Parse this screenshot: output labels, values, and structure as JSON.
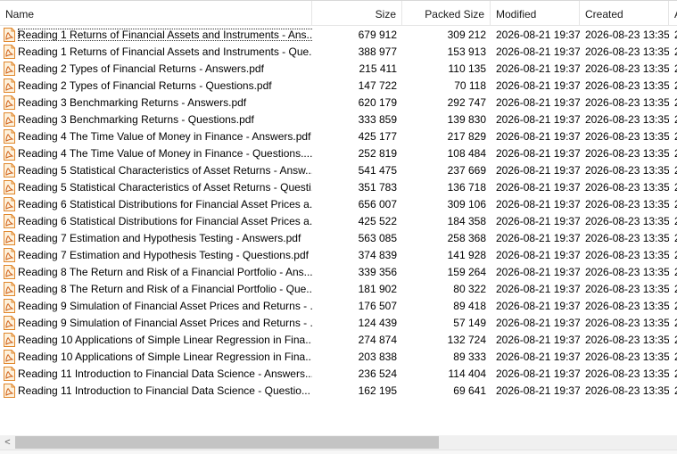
{
  "columns": {
    "name": "Name",
    "size": "Size",
    "packed": "Packed Size",
    "modified": "Modified",
    "created": "Created",
    "next": "A"
  },
  "files": [
    {
      "name": "Reading 1 Returns of Financial Assets and Instruments - Ans...",
      "size": "679 912",
      "packed": "309 212",
      "modified": "2026-08-21 19:37",
      "created": "2026-08-23 13:35",
      "extra": "2"
    },
    {
      "name": "Reading 1 Returns of Financial Assets and Instruments - Que...",
      "size": "388 977",
      "packed": "153 913",
      "modified": "2026-08-21 19:37",
      "created": "2026-08-23 13:35",
      "extra": "2"
    },
    {
      "name": "Reading 2 Types of Financial Returns - Answers.pdf",
      "size": "215 411",
      "packed": "110 135",
      "modified": "2026-08-21 19:37",
      "created": "2026-08-23 13:35",
      "extra": "2"
    },
    {
      "name": "Reading 2 Types of Financial Returns - Questions.pdf",
      "size": "147 722",
      "packed": "70 118",
      "modified": "2026-08-21 19:37",
      "created": "2026-08-23 13:35",
      "extra": "2"
    },
    {
      "name": "Reading 3 Benchmarking Returns - Answers.pdf",
      "size": "620 179",
      "packed": "292 747",
      "modified": "2026-08-21 19:37",
      "created": "2026-08-23 13:35",
      "extra": "2"
    },
    {
      "name": "Reading 3 Benchmarking Returns - Questions.pdf",
      "size": "333 859",
      "packed": "139 830",
      "modified": "2026-08-21 19:37",
      "created": "2026-08-23 13:35",
      "extra": "2"
    },
    {
      "name": "Reading 4 The Time Value of Money in Finance - Answers.pdf",
      "size": "425 177",
      "packed": "217 829",
      "modified": "2026-08-21 19:37",
      "created": "2026-08-23 13:35",
      "extra": "2"
    },
    {
      "name": "Reading 4 The Time Value of Money in Finance - Questions....",
      "size": "252 819",
      "packed": "108 484",
      "modified": "2026-08-21 19:37",
      "created": "2026-08-23 13:35",
      "extra": "2"
    },
    {
      "name": "Reading 5 Statistical Characteristics of Asset Returns - Answ...",
      "size": "541 475",
      "packed": "237 669",
      "modified": "2026-08-21 19:37",
      "created": "2026-08-23 13:35",
      "extra": "2"
    },
    {
      "name": "Reading 5 Statistical Characteristics of Asset Returns - Questi...",
      "size": "351 783",
      "packed": "136 718",
      "modified": "2026-08-21 19:37",
      "created": "2026-08-23 13:35",
      "extra": "2"
    },
    {
      "name": "Reading 6 Statistical Distributions for Financial Asset Prices a...",
      "size": "656 007",
      "packed": "309 106",
      "modified": "2026-08-21 19:37",
      "created": "2026-08-23 13:35",
      "extra": "2"
    },
    {
      "name": "Reading 6 Statistical Distributions for Financial Asset Prices a...",
      "size": "425 522",
      "packed": "184 358",
      "modified": "2026-08-21 19:37",
      "created": "2026-08-23 13:35",
      "extra": "2"
    },
    {
      "name": "Reading 7 Estimation and Hypothesis Testing - Answers.pdf",
      "size": "563 085",
      "packed": "258 368",
      "modified": "2026-08-21 19:37",
      "created": "2026-08-23 13:35",
      "extra": "2"
    },
    {
      "name": "Reading 7 Estimation and Hypothesis Testing - Questions.pdf",
      "size": "374 839",
      "packed": "141 928",
      "modified": "2026-08-21 19:37",
      "created": "2026-08-23 13:35",
      "extra": "2"
    },
    {
      "name": "Reading 8 The Return and Risk of a Financial Portfolio - Ans...",
      "size": "339 356",
      "packed": "159 264",
      "modified": "2026-08-21 19:37",
      "created": "2026-08-23 13:35",
      "extra": "2"
    },
    {
      "name": "Reading 8 The Return and Risk of a Financial Portfolio - Que...",
      "size": "181 902",
      "packed": "80 322",
      "modified": "2026-08-21 19:37",
      "created": "2026-08-23 13:35",
      "extra": "2"
    },
    {
      "name": "Reading 9 Simulation of Financial Asset Prices and Returns - ...",
      "size": "176 507",
      "packed": "89 418",
      "modified": "2026-08-21 19:37",
      "created": "2026-08-23 13:35",
      "extra": "2"
    },
    {
      "name": "Reading 9 Simulation of Financial Asset Prices and Returns - ...",
      "size": "124 439",
      "packed": "57 149",
      "modified": "2026-08-21 19:37",
      "created": "2026-08-23 13:35",
      "extra": "2"
    },
    {
      "name": "Reading 10 Applications of Simple Linear Regression in Fina...",
      "size": "274 874",
      "packed": "132 724",
      "modified": "2026-08-21 19:37",
      "created": "2026-08-23 13:35",
      "extra": "2"
    },
    {
      "name": "Reading 10 Applications of Simple Linear Regression in Fina...",
      "size": "203 838",
      "packed": "89 333",
      "modified": "2026-08-21 19:37",
      "created": "2026-08-23 13:35",
      "extra": "2"
    },
    {
      "name": "Reading 11 Introduction to Financial Data Science - Answers....",
      "size": "236 524",
      "packed": "114 404",
      "modified": "2026-08-21 19:37",
      "created": "2026-08-23 13:35",
      "extra": "2"
    },
    {
      "name": "Reading 11 Introduction to Financial Data Science - Questio...",
      "size": "162 195",
      "packed": "69 641",
      "modified": "2026-08-21 19:37",
      "created": "2026-08-23 13:35",
      "extra": "2"
    }
  ],
  "focused_index": 0,
  "icon_name": "pdf-file-icon",
  "scrollbar": {
    "left_arrow": "<"
  },
  "colors": {
    "icon_border": "#e0862a",
    "icon_fill": "#fdf1dc",
    "icon_mark": "#cf5f16"
  }
}
